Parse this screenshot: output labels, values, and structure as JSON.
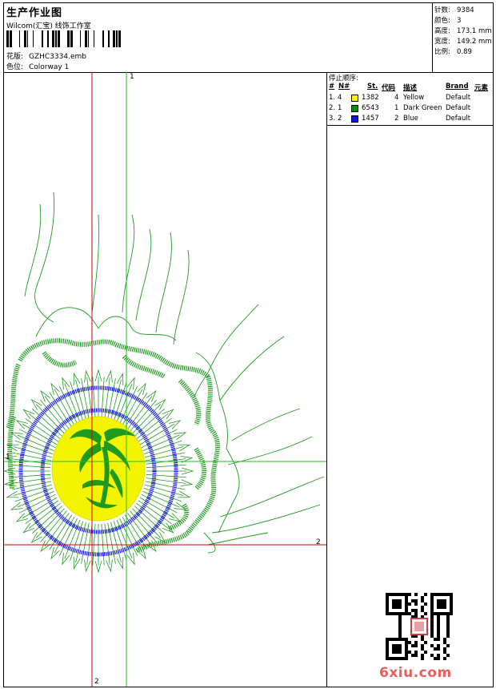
{
  "header": {
    "title": "生产作业图",
    "company": "Wilcom(汇宝) 线饰工作室",
    "design_label": "花版:",
    "design_value": "GZHC3334.emb",
    "colorway_label": "色位:",
    "colorway_value": "Colorway 1"
  },
  "stats": [
    {
      "label": "针数:",
      "value": "9384"
    },
    {
      "label": "颜色:",
      "value": "3"
    },
    {
      "label": "高度:",
      "value": "173.1 mm"
    },
    {
      "label": "宽度:",
      "value": "149.2 mm"
    },
    {
      "label": "比例:",
      "value": "0.89"
    }
  ],
  "stop_sequence": {
    "title": "停止顺序:",
    "headers": {
      "num": "#",
      "no": "N#",
      "st": "St.",
      "code": "代码",
      "desc": "描述",
      "brand": "Brand",
      "element": "元素"
    },
    "rows": [
      {
        "num": "1.",
        "no": "4",
        "color": "#f4f400",
        "st": "1382",
        "code": "4",
        "desc": "Yellow",
        "brand": "Default"
      },
      {
        "num": "2.",
        "no": "1",
        "color": "#0a8a0a",
        "st": "6543",
        "code": "1",
        "desc": "Dark Green",
        "brand": "Default"
      },
      {
        "num": "3.",
        "no": "2",
        "color": "#1414e0",
        "st": "1457",
        "code": "2",
        "desc": "Blue",
        "brand": "Default"
      }
    ]
  },
  "axis_labels": {
    "top": "1",
    "left": "1",
    "right": "2",
    "bottom": "2"
  },
  "watermark": "6xiu.com",
  "colors": {
    "yellow": "#f4f400",
    "green": "#1f9a1f",
    "blue": "#1414e0",
    "red": "#d40000",
    "guide": "#22c022"
  }
}
